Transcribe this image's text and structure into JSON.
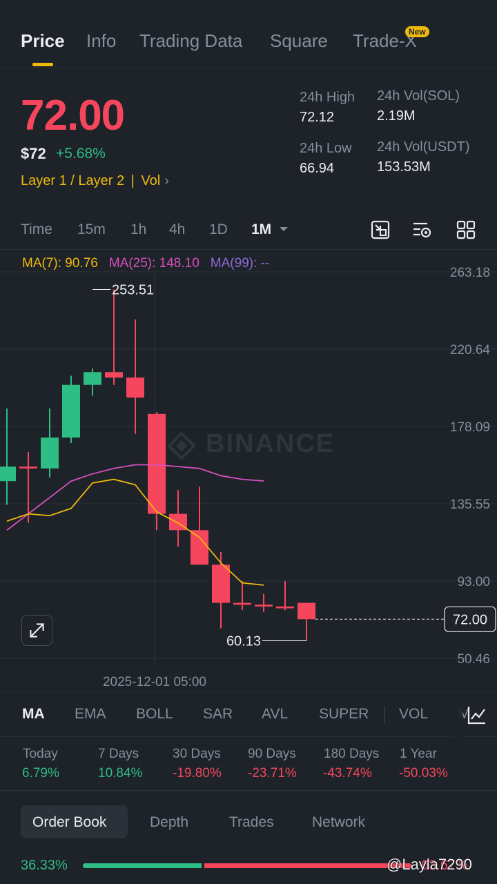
{
  "tabs": [
    {
      "label": "Price"
    },
    {
      "label": "Info"
    },
    {
      "label": "Trading Data"
    },
    {
      "label": "Square"
    },
    {
      "label": "Trade-X"
    }
  ],
  "new_badge": "New",
  "price": {
    "last": "72.00",
    "usd": "$72",
    "change": "+5.68%",
    "tag1": "Layer 1 / Layer 2",
    "tag2": "Vol",
    "color_down": "#f6465d",
    "color_up": "#2ebd85"
  },
  "stats": {
    "high_label": "24h High",
    "high_value": "72.12",
    "low_label": "24h Low",
    "low_value": "66.94",
    "vol_base_label": "24h Vol(SOL)",
    "vol_base_value": "2.19M",
    "vol_quote_label": "24h Vol(USDT)",
    "vol_quote_value": "153.53M"
  },
  "intervals": [
    "Time",
    "15m",
    "1h",
    "4h",
    "1D",
    "1M"
  ],
  "ma_legend": {
    "ma7": "MA(7): 90.76",
    "ma25": "MA(25): 148.10",
    "ma99": "MA(99): --"
  },
  "watermark": "BINANCE",
  "chart_data": {
    "type": "candlestick",
    "y_ticks": [
      "263.18",
      "220.64",
      "178.09",
      "135.55",
      "93.00",
      "50.46"
    ],
    "y_range": [
      50.46,
      263.18
    ],
    "x_label": "2025-12-01 05:00",
    "current_price": "72.00",
    "high_annotation": "253.51",
    "low_annotation": "60.13",
    "candles": [
      {
        "o": 148,
        "h": 188,
        "l": 135,
        "c": 156
      },
      {
        "o": 156,
        "h": 164,
        "l": 125,
        "c": 155
      },
      {
        "o": 155,
        "h": 188,
        "l": 150,
        "c": 172
      },
      {
        "o": 172,
        "h": 206,
        "l": 169,
        "c": 201
      },
      {
        "o": 201,
        "h": 210,
        "l": 195,
        "c": 208
      },
      {
        "o": 208,
        "h": 253.51,
        "l": 201,
        "c": 205
      },
      {
        "o": 205,
        "h": 237,
        "l": 174,
        "c": 194
      },
      {
        "o": 185,
        "h": 186,
        "l": 121,
        "c": 130
      },
      {
        "o": 130,
        "h": 143,
        "l": 112,
        "c": 121
      },
      {
        "o": 121,
        "h": 145,
        "l": 103,
        "c": 102
      },
      {
        "o": 102,
        "h": 109,
        "l": 67,
        "c": 81
      },
      {
        "o": 81,
        "h": 93,
        "l": 77,
        "c": 80
      },
      {
        "o": 80,
        "h": 86,
        "l": 76,
        "c": 79
      },
      {
        "o": 79,
        "h": 93,
        "l": 77,
        "c": 78
      },
      {
        "o": 81,
        "h": 81,
        "l": 60.13,
        "c": 72
      }
    ],
    "ma7": [
      126,
      130,
      129,
      133,
      147,
      149,
      146,
      131,
      125,
      117,
      103,
      92,
      90.76
    ],
    "ma25": [
      121,
      130,
      139,
      148,
      152,
      155,
      157,
      157,
      156,
      155,
      151,
      149,
      148.1
    ],
    "colors": {
      "up": "#2ebd85",
      "down": "#f6465d",
      "ma7": "#f0b90b",
      "ma25": "#d64fbf",
      "ma99": "#8c6ad4"
    }
  },
  "indicators": [
    "MA",
    "EMA",
    "BOLL",
    "SAR",
    "AVL",
    "SUPER",
    "VOL",
    "M"
  ],
  "performance": [
    {
      "label": "Today",
      "value": "6.79%"
    },
    {
      "label": "7 Days",
      "value": "10.84%"
    },
    {
      "label": "30 Days",
      "value": "-19.80%"
    },
    {
      "label": "90 Days",
      "value": "-23.71%"
    },
    {
      "label": "180 Days",
      "value": "-43.74%"
    },
    {
      "label": "1 Year",
      "value": "-50.03%"
    }
  ],
  "orderbook_tabs": [
    "Order Book",
    "Depth",
    "Trades",
    "Network"
  ],
  "orderbook": {
    "bid_pct": "36.33%",
    "ask_pct": "63.67%"
  },
  "credit": "@Layla7290"
}
